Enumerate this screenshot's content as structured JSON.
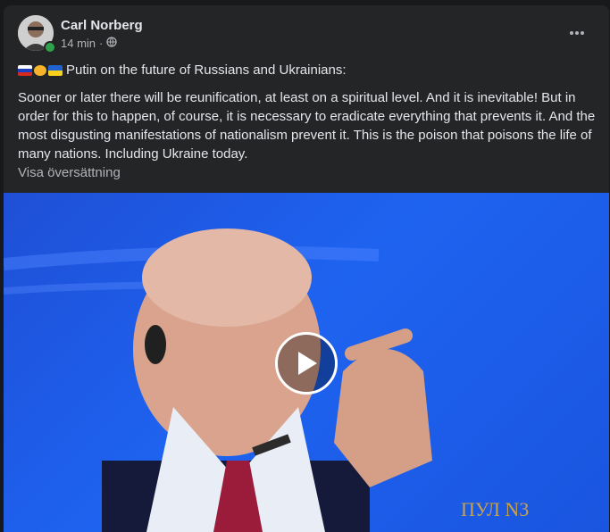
{
  "author": {
    "name": "Carl Norberg",
    "online": true
  },
  "meta": {
    "time": "14 min",
    "separator": "·",
    "audience_icon": "globe-icon"
  },
  "post": {
    "headline": "Putin on the future of Russians and Ukrainians:",
    "body": "Sooner or later there will be reunification, at least on a spiritual level. And it is inevitable! But in order for this to happen, of course, it is necessary to eradicate everything that prevents it. And the most disgusting manifestations of nationalism prevent it. This is the poison that poisons the life of many nations. Including Ukraine today.",
    "emojis": [
      "russia-flag-icon",
      "handshake-icon",
      "ukraine-flag-icon"
    ]
  },
  "translate_link": "Visa översättning",
  "video": {
    "watermark": "ПУЛ N3",
    "play_icon": "play-icon"
  },
  "colors": {
    "background": "#242526",
    "text": "#e4e6eb",
    "muted": "#b0b3b8",
    "online": "#31a24c"
  }
}
